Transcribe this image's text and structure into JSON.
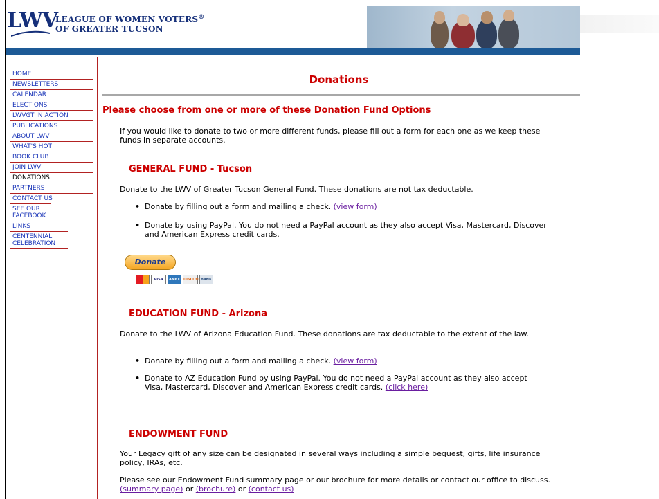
{
  "header": {
    "logo_mark": "LWV",
    "org_line1": "LEAGUE OF WOMEN VOTERS",
    "org_reg": "®",
    "org_line2": "OF GREATER TUCSON"
  },
  "sidebar": {
    "items": [
      {
        "label": "HOME"
      },
      {
        "label": "NEWSLETTERS"
      },
      {
        "label": "CALENDAR"
      },
      {
        "label": "ELECTIONS"
      },
      {
        "label": "LWVGT IN ACTION"
      },
      {
        "label": "PUBLICATIONS"
      },
      {
        "label": "ABOUT LWV"
      },
      {
        "label": "WHAT'S HOT"
      },
      {
        "label": "BOOK CLUB"
      },
      {
        "label": "JOIN LWV"
      },
      {
        "label": "DONATIONS"
      },
      {
        "label": "PARTNERS"
      },
      {
        "label": "CONTACT US"
      },
      {
        "label": "SEE OUR FACEBOOK"
      },
      {
        "label": "LINKS"
      },
      {
        "label": "CENTENNIAL CELEBRATION"
      }
    ]
  },
  "main": {
    "title": "Donations",
    "intro_heading": "Please choose from one or more of these Donation Fund Options",
    "intro_text": "If you would like to donate to two or more different funds, please fill out a form for each one as we keep these funds in separate accounts.",
    "general": {
      "heading": "GENERAL FUND - Tucson",
      "desc": "Donate to the LWV of Greater Tucson General Fund. These donations are not tax deductable.",
      "bullet1": "Donate by filling out a form and mailing a check.",
      "bullet1_link": "(view form)",
      "bullet2": "Donate by using PayPal. You do not need a PayPal account as they also accept Visa, Mastercard, Discover and American Express credit cards.",
      "donate_label": "Donate",
      "cards": [
        "VISA",
        "AMEX",
        "DISCOVER",
        "BANK"
      ]
    },
    "education": {
      "heading": "EDUCATION FUND - Arizona",
      "desc": "Donate to the LWV of Arizona Education Fund. These donations are tax deductable to the extent of the law.",
      "bullet1": "Donate by filling out a form and mailing a check.",
      "bullet1_link": "(view form)",
      "bullet2": "Donate to AZ Education Fund by using PayPal. You do not need a PayPal account as they also accept Visa, Mastercard, Discover and American Express credit cards.",
      "bullet2_link": "(click here)"
    },
    "endowment": {
      "heading": "ENDOWMENT FUND",
      "desc1": "Your Legacy gift of any size can be designated in several ways including a simple bequest, gifts, life insurance policy, IRAs, etc.",
      "desc2": "Please see our Endowment Fund summary page or our brochure for more details or contact our office to discuss.",
      "link_summary": "(summary page)",
      "or1": "or",
      "link_brochure": "(brochure)",
      "or2": "or",
      "link_contact": "(contact us)"
    }
  },
  "colors": {
    "brand_blue": "#16307a",
    "bar_blue": "#1d5a96",
    "heading_red": "#cc0000",
    "nav_link": "#1a35b8",
    "visited_link": "#6a1ea0"
  }
}
